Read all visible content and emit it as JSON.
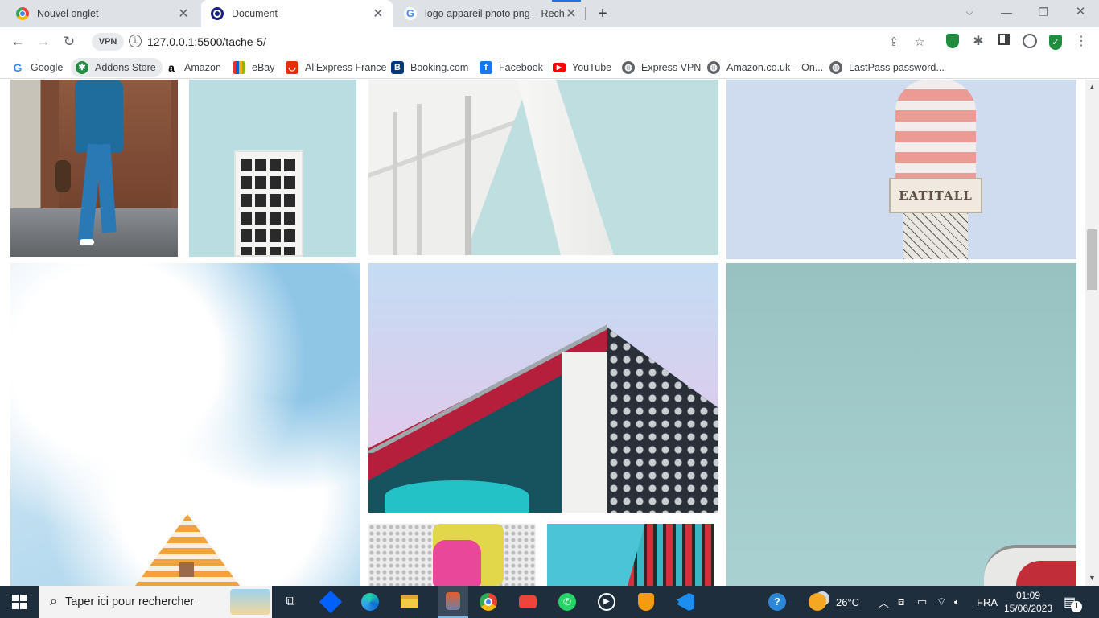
{
  "tabs": [
    {
      "title": "Nouvel onglet",
      "favicon": "chrome-icon",
      "active": false
    },
    {
      "title": "Document",
      "favicon": "globe-icon",
      "active": true
    },
    {
      "title": "logo appareil photo png – Reche",
      "favicon": "google-icon",
      "active": false
    }
  ],
  "tab_close_glyph": "✕",
  "new_tab_glyph": "+",
  "window_controls": {
    "minimize": "—",
    "restore": "❐",
    "close": "✕"
  },
  "address_bar": {
    "vpn_label": "VPN",
    "url": "127.0.0.1:5500/tache-5/"
  },
  "bookmarks": [
    {
      "label": "Google",
      "icon": "google-icon",
      "color": "#4285f4"
    },
    {
      "label": "Addons Store",
      "icon": "addons-store-icon",
      "color": "#1e8e3e"
    },
    {
      "label": "Amazon",
      "icon": "amazon-icon",
      "color": "#000000"
    },
    {
      "label": "eBay",
      "icon": "ebay-icon",
      "color": "#e53238"
    },
    {
      "label": "AliExpress France",
      "icon": "aliexpress-icon",
      "color": "#e62e04"
    },
    {
      "label": "Booking.com",
      "icon": "booking-icon",
      "color": "#003580"
    },
    {
      "label": "Facebook",
      "icon": "facebook-icon",
      "color": "#1877f2"
    },
    {
      "label": "YouTube",
      "icon": "youtube-icon",
      "color": "#ff0000"
    },
    {
      "label": "Express VPN",
      "icon": "globe-icon",
      "color": "#5f6368"
    },
    {
      "label": "Amazon.co.uk – On...",
      "icon": "globe-icon",
      "color": "#5f6368"
    },
    {
      "label": "LastPass password...",
      "icon": "globe-icon",
      "color": "#5f6368"
    }
  ],
  "gallery_images": [
    {
      "subject": "man-walking-street"
    },
    {
      "subject": "white-building-window"
    },
    {
      "subject": "white-architecture-column"
    },
    {
      "subject": "ice-cream-sign"
    },
    {
      "subject": "clouds-pyramid"
    },
    {
      "subject": "modern-building-red-roof"
    },
    {
      "subject": "teal-sky"
    },
    {
      "subject": "yellow-jacket-backpack"
    },
    {
      "subject": "colorful-facade"
    }
  ],
  "ice_cream_sign_text": "EATITALL",
  "taskbar": {
    "search_placeholder": "Taper ici pour rechercher",
    "temperature": "26°C",
    "language": "FRA",
    "time": "01:09",
    "date": "15/06/2023",
    "notification_count": "1"
  }
}
